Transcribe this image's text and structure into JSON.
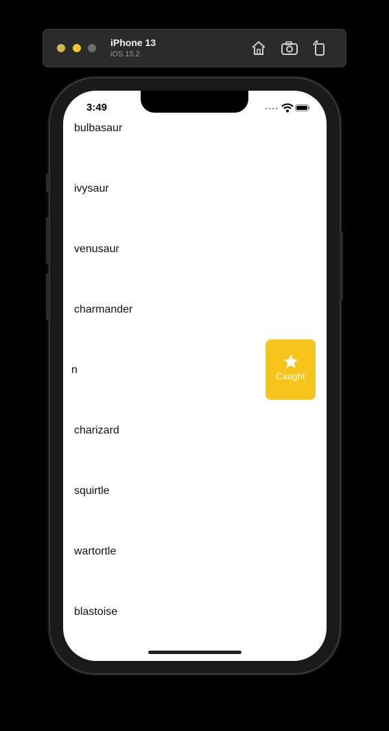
{
  "simulator": {
    "device_name": "iPhone 13",
    "os_version": "iOS 15.2",
    "icons": [
      "home-icon",
      "screenshot-icon",
      "rotate-icon"
    ]
  },
  "status_bar": {
    "time": "3:49"
  },
  "list": {
    "items": [
      "bulbasaur",
      "ivysaur",
      "venusaur",
      "charmander",
      "n",
      "charizard",
      "squirtle",
      "wartortle",
      "blastoise"
    ]
  },
  "swipe_action": {
    "label": "Caught",
    "icon": "star-icon",
    "color": "#f5c51b"
  }
}
